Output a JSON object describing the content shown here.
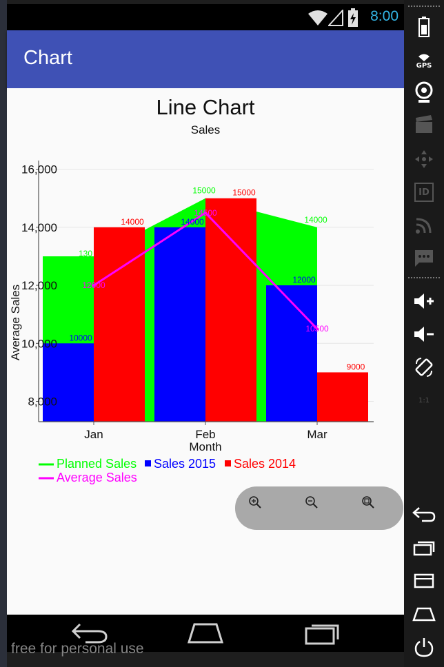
{
  "status": {
    "time": "8:00"
  },
  "app": {
    "title": "Chart"
  },
  "watermark": "free for personal use",
  "colors": {
    "app_bar": "#3f51b5",
    "planned": "#00ff00",
    "s2015": "#0000ff",
    "s2014": "#ff0000",
    "average": "#ff00ff",
    "time": "#33b5e5"
  },
  "right_panel": {
    "gps_label": "GPS",
    "id_label": "ID",
    "ratio_label": "1:1"
  },
  "icons": [
    "battery-icon",
    "gps-icon",
    "webcam-icon",
    "clapper-icon",
    "dpad-icon",
    "id-icon",
    "rss-icon",
    "sms-icon",
    "volume-up-icon",
    "volume-down-icon",
    "rotate-icon",
    "scale-icon",
    "back-icon",
    "recents-icon",
    "menu-icon",
    "home-icon",
    "power-icon",
    "zoom-in-icon",
    "zoom-out-icon",
    "zoom-reset-icon",
    "wifi-icon",
    "signal-icon"
  ],
  "chart_data": {
    "type": "bar",
    "title": "Line Chart",
    "subtitle": "Sales",
    "xlabel": "Month",
    "ylabel": "Average Sales",
    "categories": [
      "Jan",
      "Feb",
      "Mar"
    ],
    "ylim": [
      7300,
      16300
    ],
    "yticks": [
      8000,
      10000,
      12000,
      14000,
      16000
    ],
    "ytick_labels": [
      "8,000",
      "10,000",
      "12,000",
      "14,000",
      "16,000"
    ],
    "grid": true,
    "legend_position": "bottom-left",
    "series": [
      {
        "name": "Planned Sales",
        "type": "area",
        "color": "#00ff00",
        "values": [
          13000,
          15000,
          14000
        ],
        "labels": [
          "130",
          "15000",
          "14000"
        ]
      },
      {
        "name": "Sales 2015",
        "type": "bar",
        "color": "#0000ff",
        "values": [
          10000,
          14000,
          12000
        ],
        "labels": [
          "10000",
          "14000",
          "12000"
        ]
      },
      {
        "name": "Sales 2014",
        "type": "bar",
        "color": "#ff0000",
        "values": [
          14000,
          15000,
          9000
        ],
        "labels": [
          "14000",
          "15000",
          "9000"
        ]
      },
      {
        "name": "Average Sales",
        "type": "line",
        "color": "#ff00ff",
        "values": [
          12000,
          14500,
          10500
        ],
        "labels": [
          "12000",
          "14500",
          "10500"
        ]
      }
    ]
  }
}
